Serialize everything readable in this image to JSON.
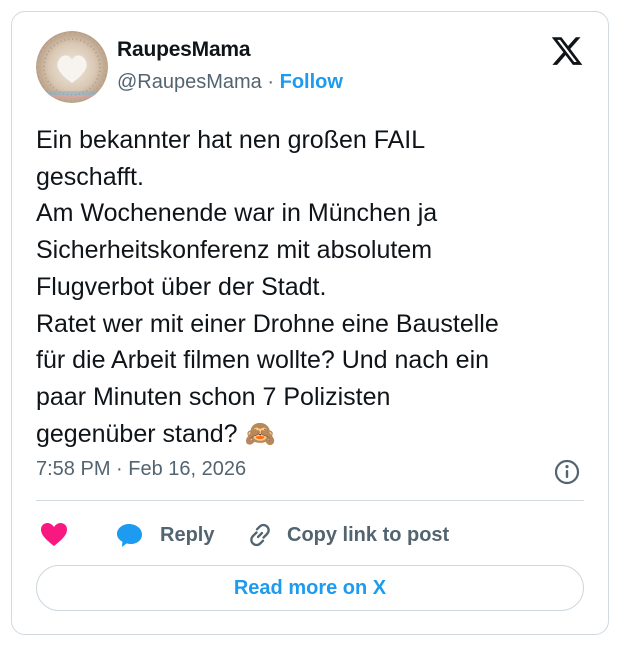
{
  "author": {
    "display_name": "RaupesMama",
    "handle": "@RaupesMama",
    "separator": "·",
    "follow_label": "Follow"
  },
  "brand": {
    "logo_icon": "x-logo-icon"
  },
  "tweet": {
    "lines": [
      "Ein bekannter hat nen großen FAIL",
      "geschafft.",
      "Am Wochenende war in München ja",
      "Sicherheitskonferenz mit absolutem",
      "Flugverbot über der Stadt.",
      "Ratet wer mit einer Drohne eine Baustelle",
      "für die Arbeit filmen wollte? Und nach ein",
      "paar Minuten schon 7 Polizisten",
      "gegenüber stand? 🙈"
    ],
    "time": "7:58 PM",
    "separator": "·",
    "date": "Feb 16, 2026"
  },
  "actions": {
    "like_icon": "heart-icon",
    "reply_label": "Reply",
    "reply_icon": "speech-bubble-icon",
    "copy_label": "Copy link to post",
    "copy_icon": "link-icon",
    "info_icon": "info-icon"
  },
  "read_more_label": "Read more on X",
  "colors": {
    "accent": "#1d9bf0",
    "like": "#f91880",
    "text": "#0f1419",
    "secondary_text": "#536471",
    "border": "#cfd9de"
  }
}
